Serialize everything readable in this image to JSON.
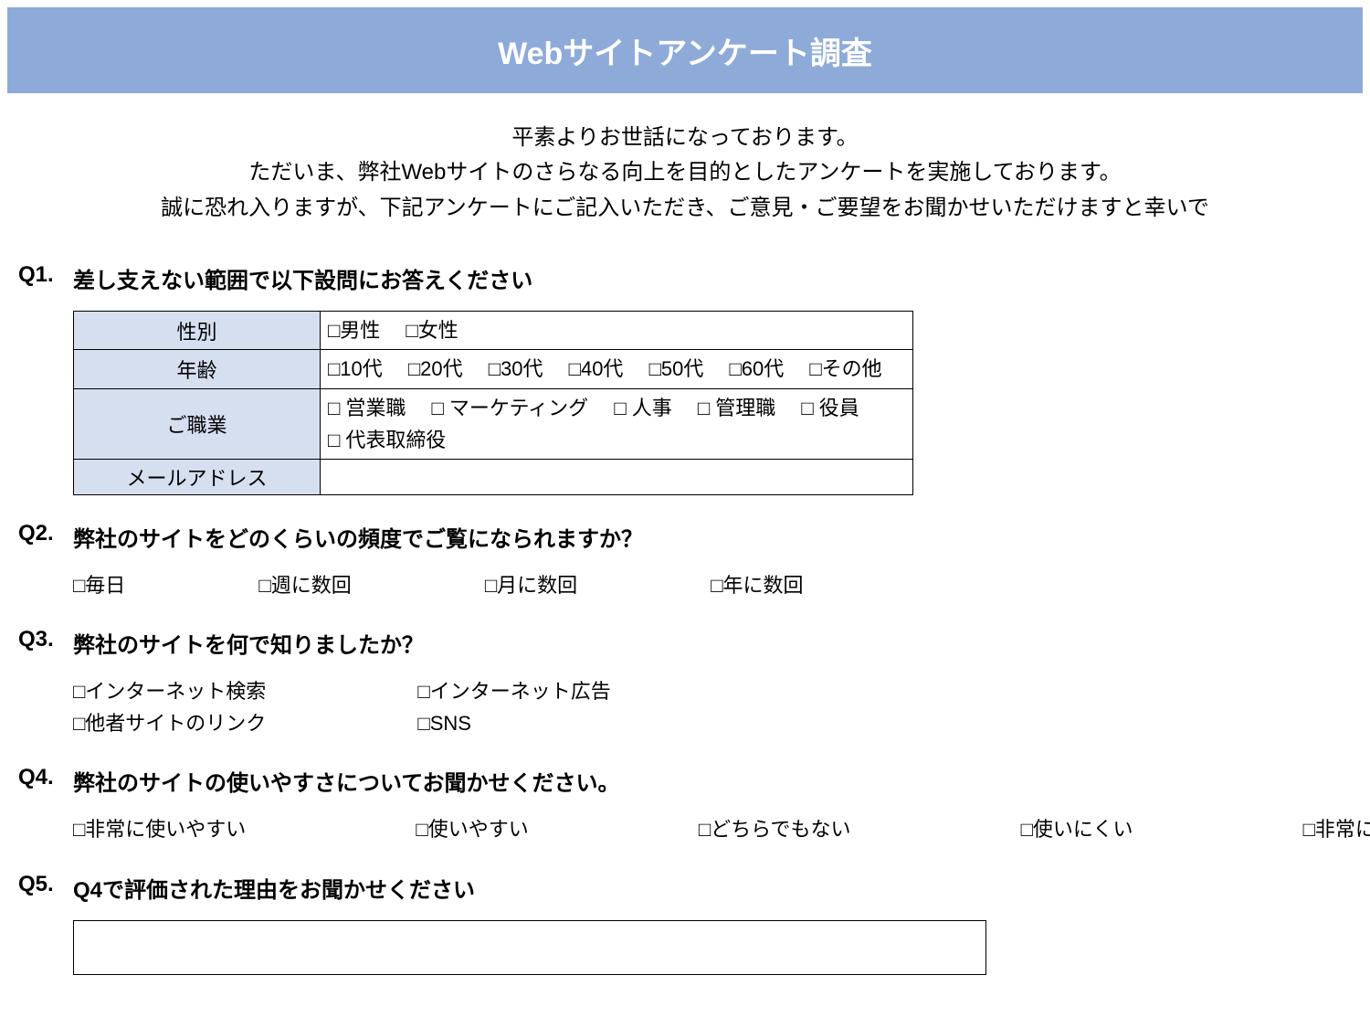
{
  "header": {
    "title": "Webサイトアンケート調査"
  },
  "intro": {
    "line1": "平素よりお世話になっております。",
    "line2": "ただいま、弊社Webサイトのさらなる向上を目的としたアンケートを実施しております。",
    "line3": "誠に恐れ入りますが、下記アンケートにご記入いただき、ご意見・ご要望をお聞かせいただけますと幸いで"
  },
  "q1": {
    "number": "Q1.",
    "text": "差し支えない範囲で以下設問にお答えください",
    "rows": {
      "sex": {
        "label": "性別",
        "opts": [
          "男性",
          "女性"
        ]
      },
      "age": {
        "label": "年齢",
        "opts": [
          "10代",
          "20代",
          "30代",
          "40代",
          "50代",
          "60代",
          "その他"
        ]
      },
      "job": {
        "label": "ご職業",
        "opts": [
          "営業職",
          "マーケティング",
          "人事",
          "管理職",
          "役員",
          "代表取締役"
        ]
      },
      "email": {
        "label": "メールアドレス"
      }
    }
  },
  "q2": {
    "number": "Q2.",
    "text": "弊社のサイトをどのくらいの頻度でご覧になられますか？",
    "opts": [
      "毎日",
      "週に数回",
      "月に数回",
      "年に数回"
    ]
  },
  "q3": {
    "number": "Q3.",
    "text": "弊社のサイトを何で知りましたか？",
    "opts": [
      "インターネット検索",
      "インターネット広告",
      "他者サイトのリンク",
      "SNS"
    ]
  },
  "q4": {
    "number": "Q4.",
    "text": "弊社のサイトの使いやすさについてお聞かせください。",
    "opts": [
      "非常に使いやすい",
      "使いやすい",
      "どちらでもない",
      "使いにくい",
      "非常に使い"
    ]
  },
  "q5": {
    "number": "Q5.",
    "text": "Q4で評価された理由をお聞かせください"
  },
  "checkbox_glyph": "□"
}
